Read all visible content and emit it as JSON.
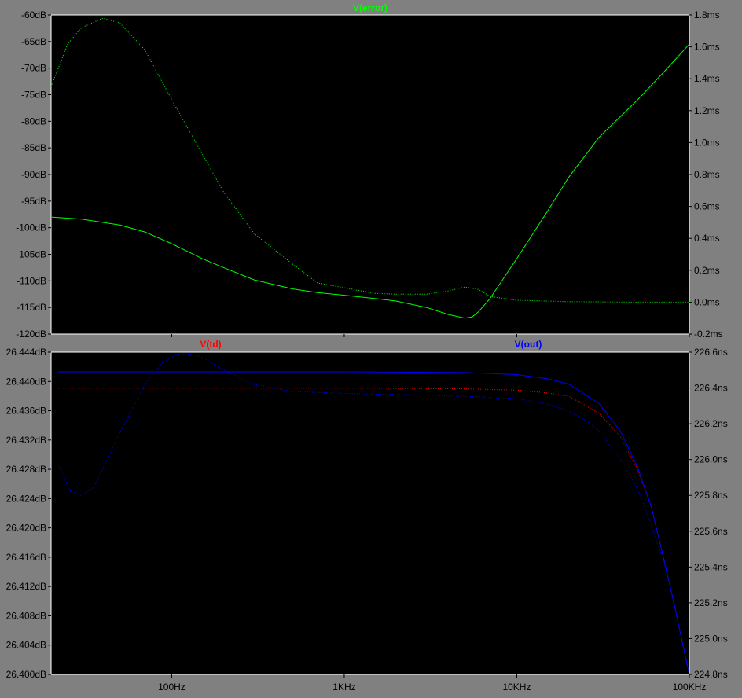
{
  "colors": {
    "background": "#808080",
    "plot_background": "#000000",
    "grid": "#808080",
    "tick_label": "#000000",
    "error_trace": "#00ff00",
    "td_trace": "#ff0000",
    "out_trace": "#0000ff"
  },
  "chart_data": [
    {
      "type": "line",
      "title": "",
      "x_scale": "log",
      "xlim": [
        20,
        100000
      ],
      "x_ticks": [
        100,
        1000,
        10000,
        100000
      ],
      "x_tick_labels": [
        "100Hz",
        "1KHz",
        "10KHz",
        "100KHz"
      ],
      "ylim_left": [
        -120,
        -60
      ],
      "left_ticks": [
        "-60dB",
        "-65dB",
        "-70dB",
        "-75dB",
        "-80dB",
        "-85dB",
        "-90dB",
        "-95dB",
        "-100dB",
        "-105dB",
        "-110dB",
        "-115dB",
        "-120dB"
      ],
      "ylim_right": [
        -0.2,
        1.8
      ],
      "right_ticks": [
        "1.8ms",
        "1.6ms",
        "1.4ms",
        "1.2ms",
        "1.0ms",
        "0.8ms",
        "0.6ms",
        "0.4ms",
        "0.2ms",
        "0.0ms",
        "-0.2ms"
      ],
      "grid": true,
      "series": [
        {
          "name": "V(error)",
          "measure": "magnitude",
          "axis": "left",
          "style": "solid",
          "color": "#00ff00",
          "x": [
            20,
            30,
            50,
            70,
            100,
            150,
            200,
            300,
            500,
            700,
            1000,
            1500,
            2000,
            3000,
            4000,
            5000,
            5500,
            6000,
            7000,
            10000,
            15000,
            20000,
            30000,
            50000,
            70000,
            100000
          ],
          "y": [
            -98.0,
            -98.4,
            -99.5,
            -100.8,
            -103.0,
            -105.8,
            -107.5,
            -109.8,
            -111.5,
            -112.2,
            -112.7,
            -113.3,
            -113.8,
            -115.0,
            -116.3,
            -117.0,
            -116.8,
            -115.8,
            -113.3,
            -105.8,
            -97.0,
            -90.5,
            -83.0,
            -76.0,
            -71.0,
            -65.5
          ]
        },
        {
          "name": "V(error)",
          "measure": "group delay",
          "axis": "right",
          "style": "dotted",
          "color": "#00ff00",
          "x": [
            20,
            25,
            30,
            40,
            50,
            70,
            100,
            150,
            200,
            300,
            500,
            700,
            1000,
            1500,
            2000,
            3000,
            4000,
            5000,
            6000,
            7000,
            10000,
            20000,
            50000,
            100000
          ],
          "y": [
            1.35,
            1.62,
            1.72,
            1.78,
            1.75,
            1.58,
            1.27,
            0.93,
            0.69,
            0.43,
            0.24,
            0.12,
            0.09,
            0.055,
            0.05,
            0.05,
            0.07,
            0.095,
            0.08,
            0.035,
            0.012,
            0.003,
            0.0,
            0.0
          ]
        }
      ]
    },
    {
      "type": "line",
      "title": "",
      "x_scale": "log",
      "xlim": [
        20,
        100000
      ],
      "x_ticks": [
        100,
        1000,
        10000,
        100000
      ],
      "x_tick_labels": [
        "100Hz",
        "1KHz",
        "10KHz",
        "100KHz"
      ],
      "ylim_left": [
        26.4,
        26.4475
      ],
      "left_ticks": [
        "26.444dB",
        "26.440dB",
        "26.436dB",
        "26.432dB",
        "26.428dB",
        "26.424dB",
        "26.420dB",
        "26.416dB",
        "26.412dB",
        "26.408dB",
        "26.404dB",
        "26.400dB"
      ],
      "ylim_right": [
        224.8,
        226.6
      ],
      "right_ticks": [
        "226.6ns",
        "226.4ns",
        "226.2ns",
        "226.0ns",
        "225.8ns",
        "225.6ns",
        "225.4ns",
        "225.2ns",
        "225.0ns",
        "224.8ns"
      ],
      "grid": true,
      "series": [
        {
          "name": "V(td)",
          "measure": "magnitude",
          "axis": "left",
          "style": "dotted",
          "color": "#ff0000",
          "x": [
            22,
            100,
            1000,
            5000,
            10000,
            15000,
            20000,
            30000,
            40000,
            50000,
            60000,
            70000,
            80000,
            100000
          ],
          "y": [
            26.4422,
            26.4422,
            26.4422,
            26.4421,
            26.4419,
            26.4415,
            26.441,
            26.4385,
            26.435,
            26.4303,
            26.4248,
            26.4178,
            26.4114,
            26.4
          ]
        },
        {
          "name": "V(out)",
          "measure": "magnitude",
          "axis": "left",
          "style": "solid",
          "color": "#0000ff",
          "x": [
            22,
            100,
            1000,
            5000,
            10000,
            15000,
            20000,
            30000,
            40000,
            50000,
            60000,
            70000,
            80000,
            100000
          ],
          "y": [
            26.4446,
            26.4446,
            26.4446,
            26.4445,
            26.4442,
            26.4436,
            26.4428,
            26.4399,
            26.4358,
            26.4306,
            26.4248,
            26.4178,
            26.4114,
            26.4
          ]
        },
        {
          "name": "V(out)",
          "measure": "group delay",
          "axis": "right",
          "style": "dotted",
          "color": "#0000ff",
          "x": [
            22,
            26,
            30,
            35,
            40,
            50,
            70,
            90,
            110,
            130,
            150,
            200,
            300,
            500,
            1000,
            3000,
            6000,
            10000,
            15000,
            20000,
            25000,
            30000,
            40000,
            50000,
            60000,
            70000,
            80000,
            100000
          ],
          "y": [
            225.97,
            225.82,
            225.8,
            225.84,
            225.95,
            226.15,
            226.42,
            226.55,
            226.59,
            226.59,
            226.57,
            226.5,
            226.42,
            226.38,
            226.37,
            226.36,
            226.35,
            226.34,
            226.31,
            226.27,
            226.22,
            226.16,
            226.0,
            225.84,
            225.64,
            225.45,
            225.24,
            224.8
          ]
        }
      ]
    }
  ]
}
